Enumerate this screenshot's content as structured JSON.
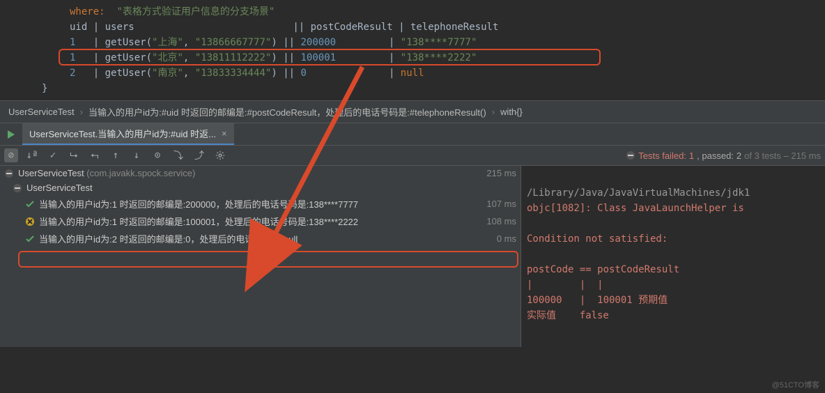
{
  "code": {
    "where_kw": "where:",
    "where_str": "\"表格方式验证用户信息的分支场景\"",
    "header_uid": "uid",
    "header_users": "users",
    "header_post": "postCodeResult",
    "header_tel": "telephoneResult",
    "r1": {
      "uid": "1",
      "call": "getUser",
      "a1": "\"上海\"",
      "a2": "\"13866667777\"",
      "post": "200000",
      "tel": "\"138****7777\""
    },
    "r2": {
      "uid": "1",
      "call": "getUser",
      "a1": "\"北京\"",
      "a2": "\"13811112222\"",
      "post": "100001",
      "tel": "\"138****2222\""
    },
    "r3": {
      "uid": "2",
      "call": "getUser",
      "a1": "\"南京\"",
      "a2": "\"13833334444\"",
      "post": "0",
      "tel": "null"
    }
  },
  "breadcrumb": {
    "a": "UserServiceTest",
    "b": "当输入的用户id为:#uid 时返回的邮编是:#postCodeResult，处理后的电话号码是:#telephoneResult()",
    "c": "with{}"
  },
  "tab": {
    "title": "UserServiceTest.当输入的用户id为:#uid 时返..."
  },
  "status": {
    "fail_label": "Tests failed:",
    "fail_n": "1",
    "pass_label": ", passed:",
    "pass_n": "2",
    "of": "of 3 tests – 215 ms"
  },
  "tree": {
    "root": {
      "label": "UserServiceTest",
      "pkg": "(com.javakk.spock.service)",
      "time": "215 ms"
    },
    "child": {
      "label": "UserServiceTest"
    },
    "t1": {
      "label": "当输入的用户id为:1 时返回的邮编是:200000，处理后的电话号码是:138****7777",
      "time": "107 ms"
    },
    "t2": {
      "label": "当输入的用户id为:1 时返回的邮编是:100001，处理后的电话号码是:138****2222",
      "time": "108 ms"
    },
    "t3": {
      "label": "当输入的用户id为:2 时返回的邮编是:0，处理后的电话号码是:null",
      "time": "0 ms"
    }
  },
  "console": {
    "l1": "/Library/Java/JavaVirtualMachines/jdk1",
    "l2": "objc[1082]: Class JavaLaunchHelper is ",
    "l3": "",
    "l4": "Condition not satisfied:",
    "l5": "",
    "l6": "postCode == postCodeResult",
    "l7": "|        |  |",
    "l8": "100000   |  100001 预期值",
    "l9": "实际值    false"
  },
  "watermark": "@51CTO博客"
}
